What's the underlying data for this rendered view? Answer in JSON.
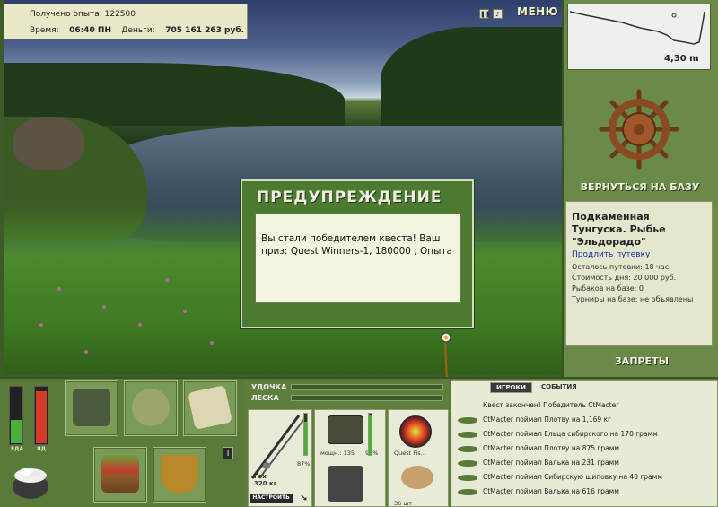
{
  "info": {
    "exp_label": "Получено опыта:",
    "exp_value": "122500",
    "time_label": "Время:",
    "time_value": "06:40 ПН",
    "money_label": "Деньги:",
    "money_value": "705 161 263 руб."
  },
  "menu_label": "МЕНЮ",
  "depth": {
    "value": "4,30 m"
  },
  "return_label": "ВЕРНУТЬСЯ НА БАЗУ",
  "base": {
    "title": "Подкаменная Тунгуска. Рыбье \"Эльдорадо\"",
    "extend_link": "Продлить путевку",
    "remaining": "Осталось путевки: 18 час.",
    "cost": "Стоимость дня: 20 000 руб.",
    "fishermen": "Рыбаков на базе: 0",
    "tournaments": "Турниры на базе: не объявлены"
  },
  "bans_label": "ЗАПРЕТЫ",
  "dialog": {
    "title": "ПРЕДУПРЕЖДЕНИЕ",
    "message": "Вы стали победителем квеста! Ваш приз: Quest Winners-1, 180000 , Опыта"
  },
  "meters": {
    "food_label": "ЕДА",
    "poison_label": "ЯД",
    "food_level": 0.4,
    "poison_level": 0.9
  },
  "tackle": {
    "rod_label": "УДОЧКА",
    "line_label": "ЛЕСКА",
    "rod_name": "Fox",
    "rod_weight": "320 кг",
    "rod_percent": "87%",
    "reel_percent": "98%",
    "reel_name": "мощн.: 135",
    "line_name": "Quest Fis...",
    "bait_count": "36 шт",
    "setup_label": "НАСТРОИТЬ"
  },
  "events": {
    "tab_players": "ИГРОКИ",
    "tab_events": "СОБЫТИЯ",
    "items": [
      "Квест закончен! Победитель CtMacter",
      "CtMacter поймал Плотву на 1,169 кг",
      "CtMacter поймал Ельца сибирского на 170 грамм",
      "CtMacter поймал Плотву на 875 грамм",
      "CtMacter поймал Валька на 231 грамм",
      "CtMacter поймал Сибирскую щиповку на 40 грамм",
      "CtMacter поймал Валька на 616 грамм"
    ]
  },
  "colors": {
    "panel_green": "#5a7a3a",
    "accent_link": "#1a2f9a"
  }
}
